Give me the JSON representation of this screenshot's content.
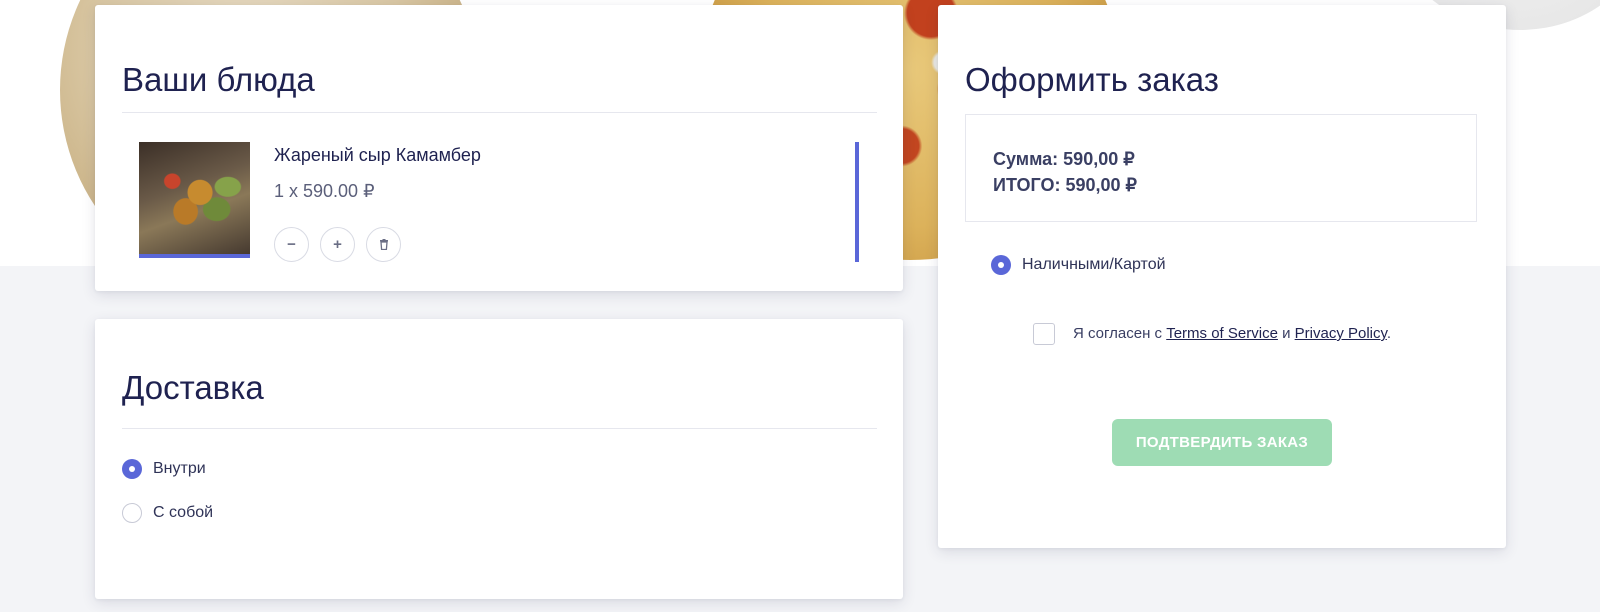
{
  "dishes": {
    "title": "Ваши блюда",
    "item": {
      "name": "Жареный сыр Камамбер",
      "price_line": "1 x 590.00 ₽",
      "minus_label": "−",
      "plus_label": "+",
      "delete_label": "🗑"
    }
  },
  "delivery": {
    "title": "Доставка",
    "options": [
      {
        "label": "Внутри",
        "selected": true
      },
      {
        "label": "С собой",
        "selected": false
      }
    ]
  },
  "order": {
    "title": "Оформить заказ",
    "sum_line": "Сумма: 590,00 ₽",
    "total_line": "ИТОГО: 590,00 ₽",
    "payment_option": "Наличными/Картой",
    "agree_prefix": "Я согласен с ",
    "terms_link": "Terms of Service",
    "agree_and": " и ",
    "privacy_link": "Privacy Policy",
    "agree_suffix": ".",
    "confirm_label": "ПОДТВЕРДИТЬ ЗАКАЗ"
  },
  "colors": {
    "accent": "#5a67d8",
    "confirm_button": "#9edcb4",
    "title_text": "#1f2250"
  }
}
